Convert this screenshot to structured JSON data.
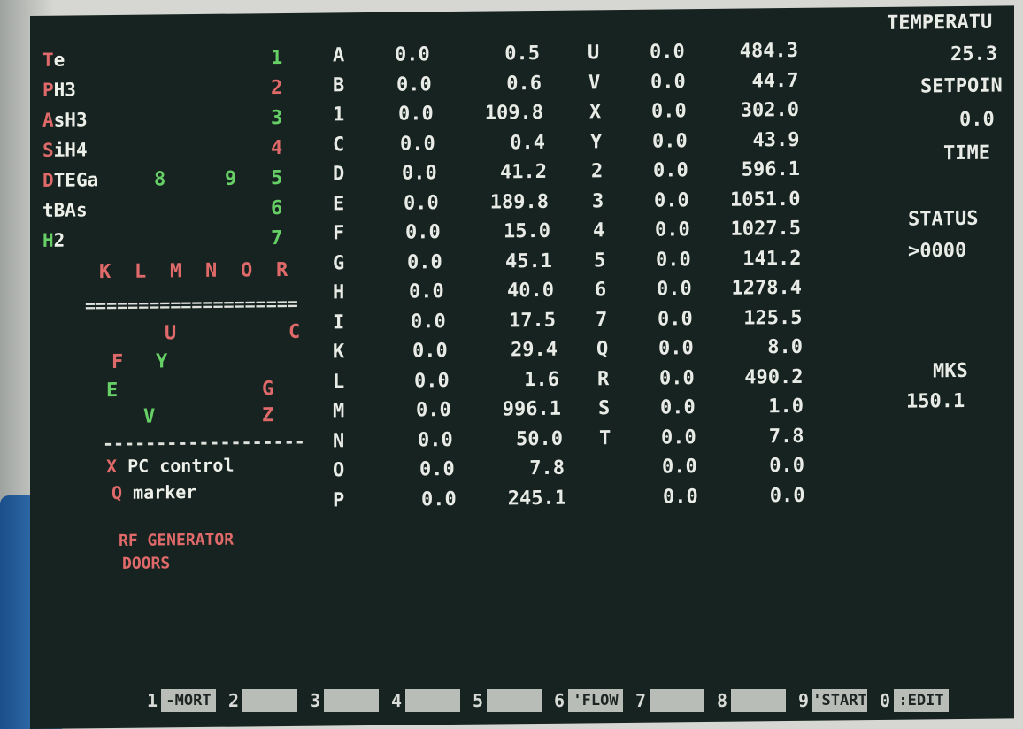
{
  "left_panel": {
    "gases": [
      {
        "first": "T",
        "rest": "e",
        "first_color": "red",
        "num": "1",
        "num_color": "green"
      },
      {
        "first": "P",
        "rest": "H3",
        "first_color": "red",
        "num": "2",
        "num_color": "red"
      },
      {
        "first": "A",
        "rest": "sH3",
        "first_color": "red",
        "num": "3",
        "num_color": "green"
      },
      {
        "first": "S",
        "rest": "iH4",
        "first_color": "red",
        "num": "4",
        "num_color": "red"
      },
      {
        "first": "D",
        "rest": "TEGa",
        "first_color": "red",
        "num": "5",
        "num_color": "green",
        "extra1": "8",
        "extra2": "9"
      },
      {
        "first": "t",
        "rest": "BAs",
        "first_color": "white",
        "num": "6",
        "num_color": "green"
      },
      {
        "first": "H",
        "rest": "2",
        "first_color": "green",
        "num": "7",
        "num_color": "green"
      }
    ],
    "valve_letters": [
      "K",
      "L",
      "M",
      "N",
      "O",
      "R"
    ],
    "double_separator": "====================",
    "diagram": {
      "U": "U",
      "C": "C",
      "F": "F",
      "Y": "Y",
      "E": "E",
      "G": "G",
      "V": "V",
      "Z": "Z"
    },
    "single_separator": "-------------------",
    "pc_control": {
      "key": "X",
      "label": " PC control"
    },
    "marker": {
      "key": "Q",
      "label": " marker"
    },
    "rf_generator": "RF GENERATOR",
    "doors": "DOORS"
  },
  "table1": [
    {
      "ch": "A",
      "set": "0.0",
      "act": "0.5"
    },
    {
      "ch": "B",
      "set": "0.0",
      "act": "0.6"
    },
    {
      "ch": "1",
      "set": "0.0",
      "act": "109.8"
    },
    {
      "ch": "C",
      "set": "0.0",
      "act": "0.4"
    },
    {
      "ch": "D",
      "set": "0.0",
      "act": "41.2"
    },
    {
      "ch": "E",
      "set": "0.0",
      "act": "189.8"
    },
    {
      "ch": "F",
      "set": "0.0",
      "act": "15.0"
    },
    {
      "ch": "G",
      "set": "0.0",
      "act": "45.1"
    },
    {
      "ch": "H",
      "set": "0.0",
      "act": "40.0"
    },
    {
      "ch": "I",
      "set": "0.0",
      "act": "17.5"
    },
    {
      "ch": "K",
      "set": "0.0",
      "act": "29.4"
    },
    {
      "ch": "L",
      "set": "0.0",
      "act": "1.6"
    },
    {
      "ch": "M",
      "set": "0.0",
      "act": "996.1"
    },
    {
      "ch": "N",
      "set": "0.0",
      "act": "50.0"
    },
    {
      "ch": "O",
      "set": "0.0",
      "act": "7.8"
    },
    {
      "ch": "P",
      "set": "0.0",
      "act": "245.1"
    }
  ],
  "table2": [
    {
      "ch": "U",
      "set": "0.0",
      "act": "484.3"
    },
    {
      "ch": "V",
      "set": "0.0",
      "act": "44.7"
    },
    {
      "ch": "X",
      "set": "0.0",
      "act": "302.0"
    },
    {
      "ch": "Y",
      "set": "0.0",
      "act": "43.9"
    },
    {
      "ch": "2",
      "set": "0.0",
      "act": "596.1"
    },
    {
      "ch": "3",
      "set": "0.0",
      "act": "1051.0"
    },
    {
      "ch": "4",
      "set": "0.0",
      "act": "1027.5"
    },
    {
      "ch": "5",
      "set": "0.0",
      "act": "141.2"
    },
    {
      "ch": "6",
      "set": "0.0",
      "act": "1278.4"
    },
    {
      "ch": "7",
      "set": "0.0",
      "act": "125.5"
    },
    {
      "ch": "Q",
      "set": "0.0",
      "act": "8.0"
    },
    {
      "ch": "R",
      "set": "0.0",
      "act": "490.2"
    },
    {
      "ch": "S",
      "set": "0.0",
      "act": "1.0"
    },
    {
      "ch": "T",
      "set": "0.0",
      "act": "7.8"
    },
    {
      "ch": "",
      "set": "0.0",
      "act": "0.0"
    },
    {
      "ch": "",
      "set": "0.0",
      "act": "0.0"
    }
  ],
  "right_panel": {
    "temperature_label": "TEMPERATU",
    "temperature_value": "25.3",
    "setpoint_label": "SETPOIN",
    "setpoint_value": "0.0",
    "time_label": "TIME",
    "status_label": "STATUS",
    "status_value": ">0000",
    "mks_label": "MKS",
    "mks_value": "150.1"
  },
  "function_keys": [
    {
      "num": "1",
      "label": "-MORT"
    },
    {
      "num": "2",
      "label": ""
    },
    {
      "num": "3",
      "label": ""
    },
    {
      "num": "4",
      "label": ""
    },
    {
      "num": "5",
      "label": ""
    },
    {
      "num": "6",
      "label": "'FLOW"
    },
    {
      "num": "7",
      "label": ""
    },
    {
      "num": "8",
      "label": ""
    },
    {
      "num": "9",
      "label": "'START"
    },
    {
      "num": "0",
      "label": ":EDIT"
    }
  ],
  "colors": {
    "screen_bg": "#172321",
    "red": "#e06a6a",
    "green": "#66d066",
    "text": "#eef0ea",
    "key_box": "#b9bdb8"
  }
}
